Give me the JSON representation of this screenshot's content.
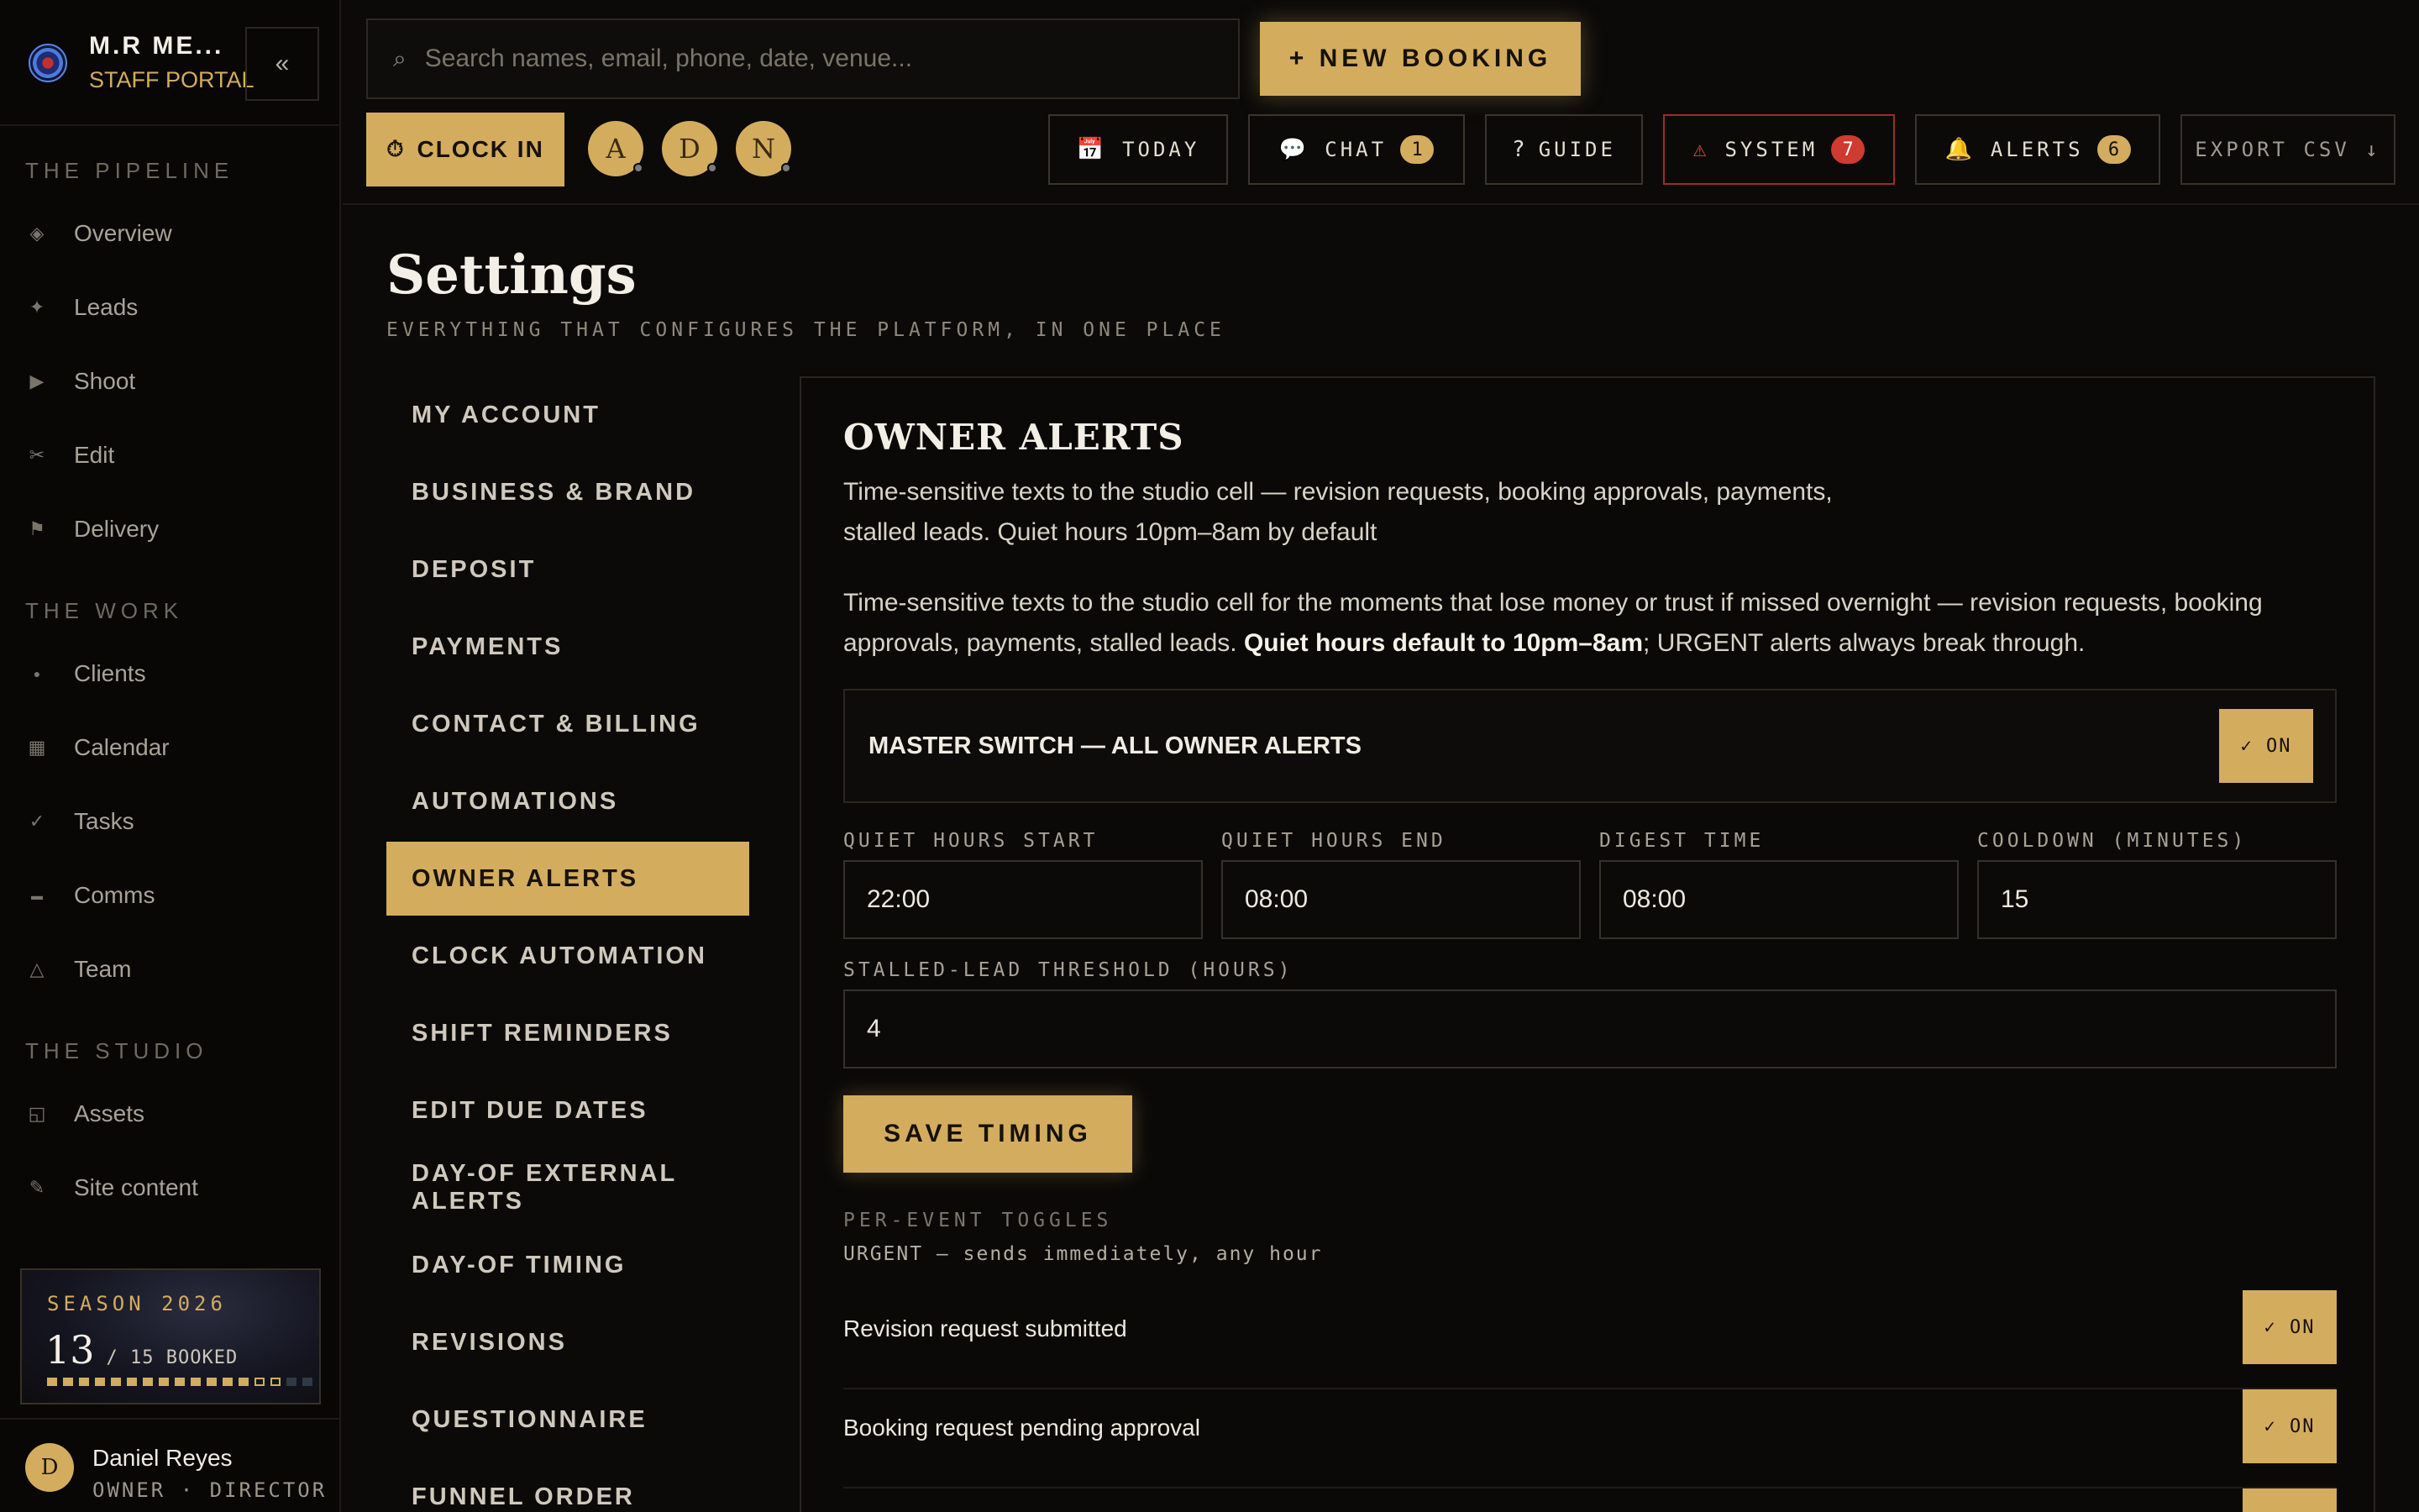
{
  "brand": {
    "name": "M.R ME...",
    "subtitle": "STAFF PORTAL",
    "collapse_label": "«"
  },
  "nav": {
    "sections": [
      {
        "title": "THE PIPELINE",
        "items": [
          {
            "label": "Overview",
            "icon": "◈"
          },
          {
            "label": "Leads",
            "icon": "✦"
          },
          {
            "label": "Shoot",
            "icon": "▶"
          },
          {
            "label": "Edit",
            "icon": "✂"
          },
          {
            "label": "Delivery",
            "icon": "⚑"
          }
        ]
      },
      {
        "title": "THE WORK",
        "items": [
          {
            "label": "Clients",
            "icon": "●"
          },
          {
            "label": "Calendar",
            "icon": "▦"
          },
          {
            "label": "Tasks",
            "icon": "✓"
          },
          {
            "label": "Comms",
            "icon": "▬"
          },
          {
            "label": "Team",
            "icon": "△"
          }
        ]
      },
      {
        "title": "THE STUDIO",
        "items": [
          {
            "label": "Assets",
            "icon": "◱"
          },
          {
            "label": "Site content",
            "icon": "✎"
          }
        ]
      }
    ]
  },
  "season": {
    "title": "SEASON 2026",
    "booked": "13",
    "of_label": "/ 15 BOOKED",
    "booked_fraction": 0.8667
  },
  "user": {
    "initial": "D",
    "name": "Daniel Reyes",
    "role": "OWNER · DIRECTOR"
  },
  "topbar": {
    "search_placeholder": "Search names, email, phone, date, venue...",
    "search_icon": "⌕",
    "new_booking": "+ NEW BOOKING",
    "clock_in": "CLOCK IN",
    "clock_icon": "⏱",
    "avatars": [
      "A",
      "D",
      "N"
    ],
    "buttons": {
      "today": {
        "label": "TODAY",
        "icon": "📅"
      },
      "chat": {
        "label": "CHAT",
        "icon": "💬",
        "badge": "1"
      },
      "guide": {
        "label": "GUIDE",
        "icon": "?"
      },
      "system": {
        "label": "SYSTEM",
        "icon": "⚠",
        "badge": "7"
      },
      "alerts": {
        "label": "ALERTS",
        "icon": "🔔",
        "badge": "6"
      },
      "export": {
        "label": "EXPORT CSV ↓"
      }
    }
  },
  "page": {
    "title": "Settings",
    "subtitle": "EVERYTHING THAT CONFIGURES THE PLATFORM, IN ONE PLACE"
  },
  "settings_nav": [
    "MY ACCOUNT",
    "BUSINESS & BRAND",
    "DEPOSIT",
    "PAYMENTS",
    "CONTACT & BILLING",
    "AUTOMATIONS",
    "OWNER ALERTS",
    "CLOCK AUTOMATION",
    "SHIFT REMINDERS",
    "EDIT DUE DATES",
    "DAY-OF EXTERNAL ALERTS",
    "DAY-OF TIMING",
    "REVISIONS",
    "QUESTIONNAIRE",
    "FUNNEL ORDER"
  ],
  "settings_nav_active": "OWNER ALERTS",
  "panel": {
    "title": "OWNER ALERTS",
    "desc1": "Time-sensitive texts to the studio cell — revision requests, booking approvals, payments, stalled leads. Quiet hours 10pm–8am by default",
    "desc2_a": "Time-sensitive texts to the studio cell for the moments that lose money or trust if missed overnight — revision requests, booking approvals, payments, stalled leads. ",
    "desc2_bold": "Quiet hours default to 10pm–8am",
    "desc2_b": "; URGENT alerts always break through.",
    "master_label": "MASTER SWITCH — ALL OWNER ALERTS",
    "toggle_on": "✓ ON",
    "fields": {
      "quiet_start": {
        "label": "QUIET HOURS START",
        "value": "22:00"
      },
      "quiet_end": {
        "label": "QUIET HOURS END",
        "value": "08:00"
      },
      "digest": {
        "label": "DIGEST TIME",
        "value": "08:00"
      },
      "cooldown": {
        "label": "COOLDOWN (MINUTES)",
        "value": "15"
      },
      "stalled": {
        "label": "STALLED-LEAD THRESHOLD (HOURS)",
        "value": "4"
      }
    },
    "save_label": "SAVE TIMING",
    "per_event_title": "PER-EVENT TOGGLES",
    "per_event_sub": "URGENT — sends immediately, any hour",
    "events": [
      {
        "label": "Revision request submitted",
        "toggle": "✓ ON"
      },
      {
        "label": "Booking request pending approval",
        "toggle": "✓ ON"
      },
      {
        "label": "",
        "toggle": ""
      }
    ]
  },
  "colors": {
    "accent": "#d4ac5e",
    "background": "#0b0a09",
    "danger": "#cf3b2f"
  }
}
